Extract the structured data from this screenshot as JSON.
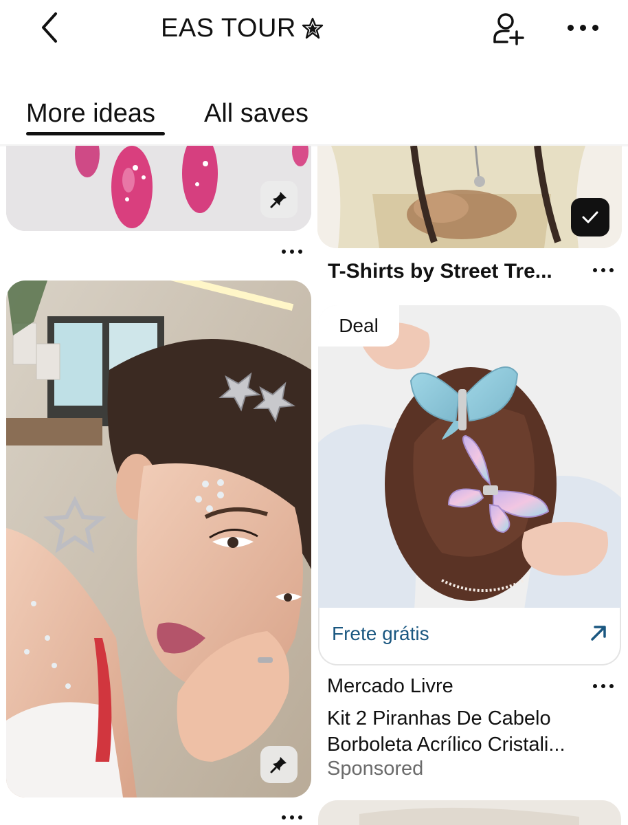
{
  "header": {
    "title": "EAS TOUR",
    "title_icon": "star-outline-icon",
    "back_icon": "chevron-left-icon",
    "add_collaborator_icon": "person-add-icon",
    "more_icon": "more-horizontal-icon"
  },
  "tabs": [
    {
      "label": "More ideas",
      "active": true
    },
    {
      "label": "All saves",
      "active": false
    }
  ],
  "pins": {
    "nails": {
      "description_icon": "pin-icon"
    },
    "tshirt": {
      "title": "T-Shirts by Street Tre...",
      "saved": true,
      "badge_icon": "check-icon"
    },
    "girl": {
      "description_icon": "pin-icon"
    },
    "ad": {
      "deal_label": "Deal",
      "link_text": "Frete grátis",
      "link_icon": "arrow-up-right-icon",
      "merchant": "Mercado Livre",
      "line1": "Kit 2 Piranhas De Cabelo",
      "line2": "Borboleta Acrílico Cristali...",
      "sponsored": "Sponsored"
    }
  },
  "colors": {
    "link": "#1a5780",
    "text": "#111111",
    "muted": "#6b6b6b"
  }
}
